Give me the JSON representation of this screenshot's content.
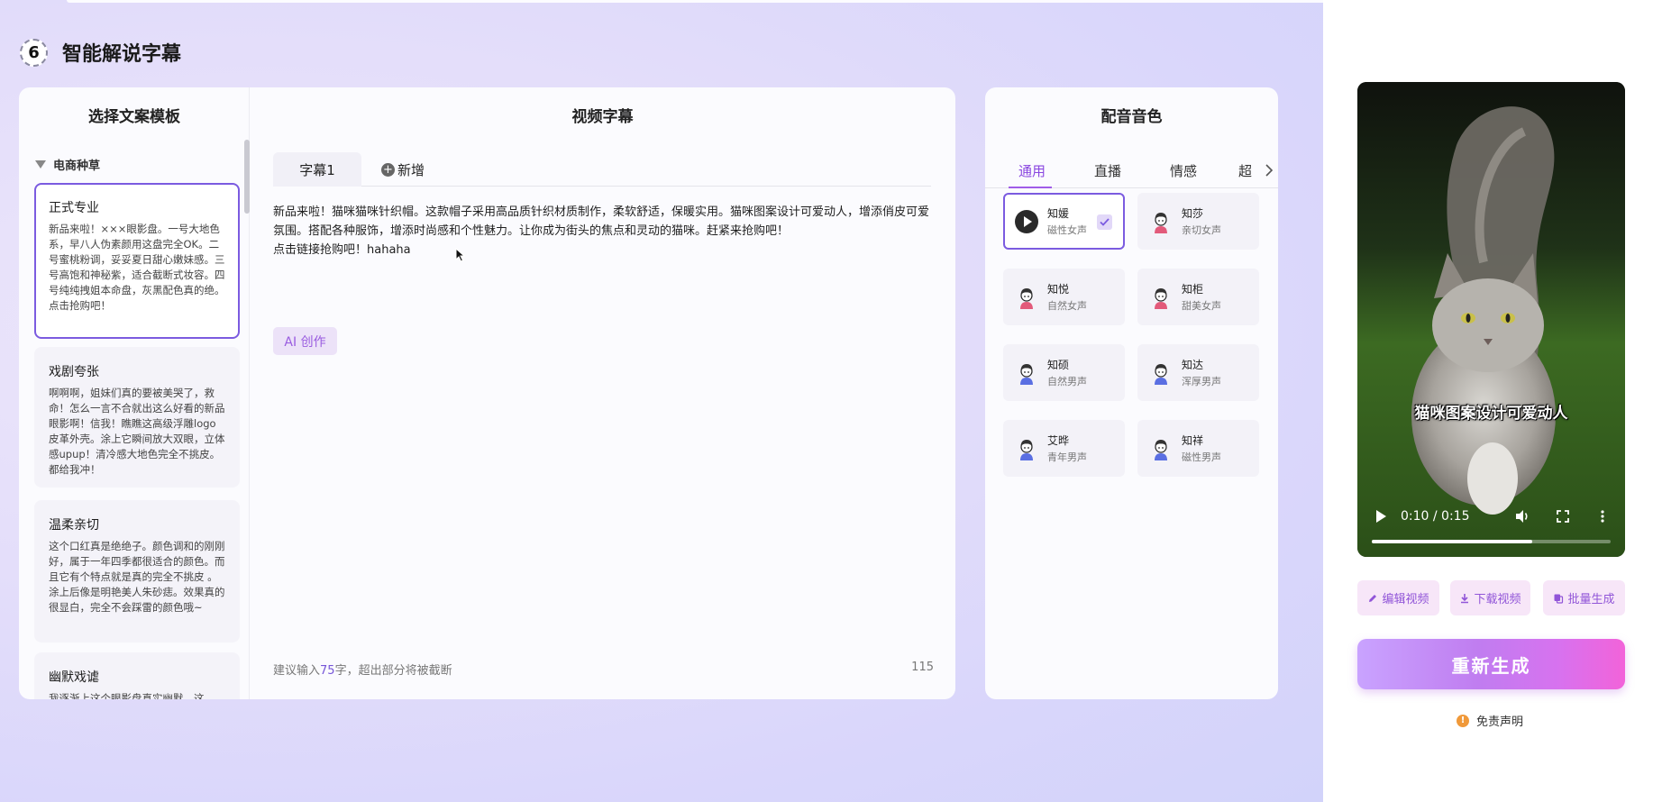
{
  "step": {
    "number": "6",
    "title": "智能解说字幕"
  },
  "templates": {
    "title": "选择文案模板",
    "group": "电商种草",
    "items": [
      {
        "name": "正式专业",
        "text": "新品来啦！×××眼影盘。一号大地色系，早八人伪素颜用这盘完全OK。二号蜜桃粉调，妥妥夏日甜心嫩妹感。三号高饱和神秘紫，适合截断式妆容。四号纯纯拽姐本命盘，灰黑配色真的绝。点击抢购吧！"
      },
      {
        "name": "戏剧夸张",
        "text": "啊啊啊，姐妹们真的要被美哭了，救命！怎么一言不合就出这么好看的新品眼影啊！信我！瞧瞧这高级浮雕logo皮革外壳。涂上它瞬间放大双眼，立体感upup！清冷感大地色完全不挑皮。都给我冲！"
      },
      {
        "name": "温柔亲切",
        "text": "这个口红真是绝绝子。颜色调和的刚刚好，属于一年四季都很适合的颜色。而且它有个特点就是真的完全不挑皮 。涂上后像是明艳美人朱砂痣。效果真的很显白，完全不会踩雷的颜色哦~"
      },
      {
        "name": "幽默戏谑",
        "text": "我逐渐上这个眼影盘真实幽默，这"
      }
    ]
  },
  "subtitle": {
    "title": "视频字幕",
    "tab_active": "字幕1",
    "tab_add": "新增",
    "text_line1": "新品来啦！猫咪猫咪针织帽。这款帽子采用高品质针织材质制作，柔软舒适，保暖实用。猫咪图案设计可爱动人，增添俏皮可爱氛围。搭配各种服饰，增添时尚感和个性魅力。让你成为街头的焦点和灵动的猫咪。赶紧来抢购吧！",
    "text_line2": "点击链接抢购吧！hahaha",
    "ai_button": "AI 创作",
    "hint_prefix": "建议输入",
    "hint_number": "75",
    "hint_suffix": "字，超出部分将被截断",
    "count": "115"
  },
  "voice": {
    "title": "配音音色",
    "tabs": [
      "通用",
      "直播",
      "情感",
      "超"
    ],
    "items": [
      {
        "name": "知媛",
        "desc": "磁性女声",
        "selected": true
      },
      {
        "name": "知莎",
        "desc": "亲切女声"
      },
      {
        "name": "知悦",
        "desc": "自然女声"
      },
      {
        "name": "知柜",
        "desc": "甜美女声"
      },
      {
        "name": "知硕",
        "desc": "自然男声"
      },
      {
        "name": "知达",
        "desc": "浑厚男声"
      },
      {
        "name": "艾晔",
        "desc": "青年男声"
      },
      {
        "name": "知祥",
        "desc": "磁性男声"
      }
    ]
  },
  "video": {
    "caption": "猫咪图案设计可爱动人",
    "time": "0:10 / 0:15",
    "progress": 0.67
  },
  "actions": {
    "edit": "编辑视频",
    "download": "下载视频",
    "batch": "批量生成",
    "regenerate": "重新生成",
    "disclaimer": "免责声明"
  },
  "colors": {
    "accent": "#7b5be0",
    "tab_active": "#8a47e0",
    "warning": "#f0993a"
  }
}
